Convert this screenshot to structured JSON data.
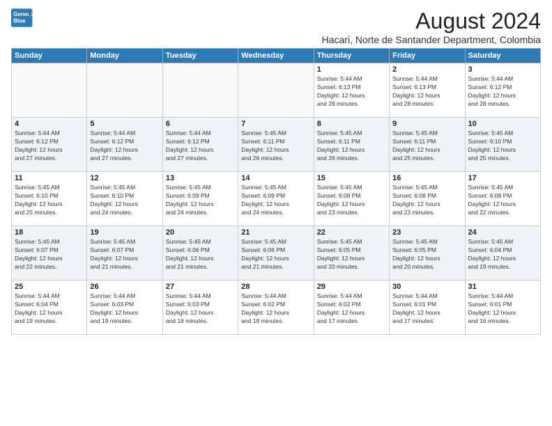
{
  "logo": {
    "line1": "General",
    "line2": "Blue"
  },
  "title": "August 2024",
  "location": "Hacari, Norte de Santander Department, Colombia",
  "days_header": [
    "Sunday",
    "Monday",
    "Tuesday",
    "Wednesday",
    "Thursday",
    "Friday",
    "Saturday"
  ],
  "weeks": [
    [
      {
        "num": "",
        "info": ""
      },
      {
        "num": "",
        "info": ""
      },
      {
        "num": "",
        "info": ""
      },
      {
        "num": "",
        "info": ""
      },
      {
        "num": "1",
        "info": "Sunrise: 5:44 AM\nSunset: 6:13 PM\nDaylight: 12 hours\nand 28 minutes."
      },
      {
        "num": "2",
        "info": "Sunrise: 5:44 AM\nSunset: 6:13 PM\nDaylight: 12 hours\nand 28 minutes."
      },
      {
        "num": "3",
        "info": "Sunrise: 5:44 AM\nSunset: 6:12 PM\nDaylight: 12 hours\nand 28 minutes."
      }
    ],
    [
      {
        "num": "4",
        "info": "Sunrise: 5:44 AM\nSunset: 6:12 PM\nDaylight: 12 hours\nand 27 minutes."
      },
      {
        "num": "5",
        "info": "Sunrise: 5:44 AM\nSunset: 6:12 PM\nDaylight: 12 hours\nand 27 minutes."
      },
      {
        "num": "6",
        "info": "Sunrise: 5:44 AM\nSunset: 6:12 PM\nDaylight: 12 hours\nand 27 minutes."
      },
      {
        "num": "7",
        "info": "Sunrise: 5:45 AM\nSunset: 6:11 PM\nDaylight: 12 hours\nand 26 minutes."
      },
      {
        "num": "8",
        "info": "Sunrise: 5:45 AM\nSunset: 6:11 PM\nDaylight: 12 hours\nand 26 minutes."
      },
      {
        "num": "9",
        "info": "Sunrise: 5:45 AM\nSunset: 6:11 PM\nDaylight: 12 hours\nand 25 minutes."
      },
      {
        "num": "10",
        "info": "Sunrise: 5:45 AM\nSunset: 6:10 PM\nDaylight: 12 hours\nand 25 minutes."
      }
    ],
    [
      {
        "num": "11",
        "info": "Sunrise: 5:45 AM\nSunset: 6:10 PM\nDaylight: 12 hours\nand 25 minutes."
      },
      {
        "num": "12",
        "info": "Sunrise: 5:45 AM\nSunset: 6:10 PM\nDaylight: 12 hours\nand 24 minutes."
      },
      {
        "num": "13",
        "info": "Sunrise: 5:45 AM\nSunset: 6:09 PM\nDaylight: 12 hours\nand 24 minutes."
      },
      {
        "num": "14",
        "info": "Sunrise: 5:45 AM\nSunset: 6:09 PM\nDaylight: 12 hours\nand 24 minutes."
      },
      {
        "num": "15",
        "info": "Sunrise: 5:45 AM\nSunset: 6:08 PM\nDaylight: 12 hours\nand 23 minutes."
      },
      {
        "num": "16",
        "info": "Sunrise: 5:45 AM\nSunset: 6:08 PM\nDaylight: 12 hours\nand 23 minutes."
      },
      {
        "num": "17",
        "info": "Sunrise: 5:45 AM\nSunset: 6:08 PM\nDaylight: 12 hours\nand 22 minutes."
      }
    ],
    [
      {
        "num": "18",
        "info": "Sunrise: 5:45 AM\nSunset: 6:07 PM\nDaylight: 12 hours\nand 22 minutes."
      },
      {
        "num": "19",
        "info": "Sunrise: 5:45 AM\nSunset: 6:07 PM\nDaylight: 12 hours\nand 21 minutes."
      },
      {
        "num": "20",
        "info": "Sunrise: 5:45 AM\nSunset: 6:06 PM\nDaylight: 12 hours\nand 21 minutes."
      },
      {
        "num": "21",
        "info": "Sunrise: 5:45 AM\nSunset: 6:06 PM\nDaylight: 12 hours\nand 21 minutes."
      },
      {
        "num": "22",
        "info": "Sunrise: 5:45 AM\nSunset: 6:05 PM\nDaylight: 12 hours\nand 20 minutes."
      },
      {
        "num": "23",
        "info": "Sunrise: 5:45 AM\nSunset: 6:05 PM\nDaylight: 12 hours\nand 20 minutes."
      },
      {
        "num": "24",
        "info": "Sunrise: 5:45 AM\nSunset: 6:04 PM\nDaylight: 12 hours\nand 19 minutes."
      }
    ],
    [
      {
        "num": "25",
        "info": "Sunrise: 5:44 AM\nSunset: 6:04 PM\nDaylight: 12 hours\nand 19 minutes."
      },
      {
        "num": "26",
        "info": "Sunrise: 5:44 AM\nSunset: 6:03 PM\nDaylight: 12 hours\nand 19 minutes."
      },
      {
        "num": "27",
        "info": "Sunrise: 5:44 AM\nSunset: 6:03 PM\nDaylight: 12 hours\nand 18 minutes."
      },
      {
        "num": "28",
        "info": "Sunrise: 5:44 AM\nSunset: 6:02 PM\nDaylight: 12 hours\nand 18 minutes."
      },
      {
        "num": "29",
        "info": "Sunrise: 5:44 AM\nSunset: 6:02 PM\nDaylight: 12 hours\nand 17 minutes."
      },
      {
        "num": "30",
        "info": "Sunrise: 5:44 AM\nSunset: 6:01 PM\nDaylight: 12 hours\nand 17 minutes."
      },
      {
        "num": "31",
        "info": "Sunrise: 5:44 AM\nSunset: 6:01 PM\nDaylight: 12 hours\nand 16 minutes."
      }
    ]
  ]
}
